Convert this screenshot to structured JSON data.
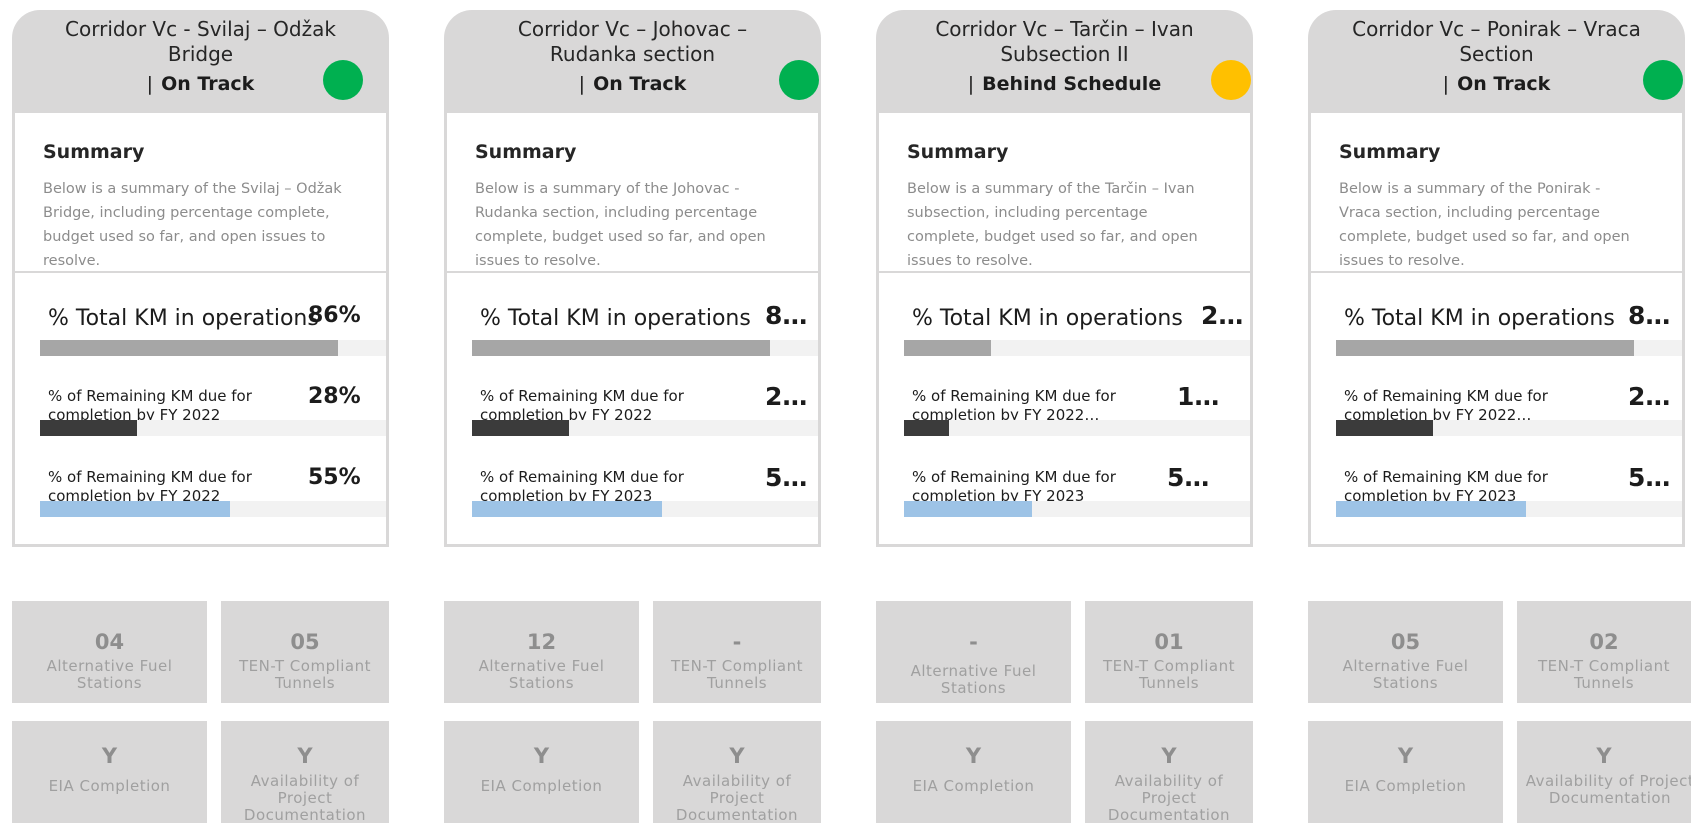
{
  "cards": [
    {
      "title": "Corridor Vc -  Svilaj – Odžak Bridge",
      "status": "On Track",
      "status_color": "#00b050",
      "summary_heading": "Summary",
      "summary_text": "Below is a summary of the Svilaj – Odžak Bridge, including percentage complete, budget used so far, and open issues to resolve.",
      "metric1": {
        "label": "% Total KM in operations",
        "value": "86%",
        "fraction": 0.86
      },
      "metric2": {
        "label": "% of Remaining KM due for completion by FY 2022",
        "value": "28%",
        "fraction": 0.28
      },
      "metric3": {
        "label": "% of Remaining KM due for completion by FY 2022",
        "value": "55%",
        "fraction": 0.55
      },
      "tiles": [
        {
          "value": "04",
          "label": "Alternative Fuel Stations"
        },
        {
          "value": "05",
          "label": "TEN-T Compliant Tunnels"
        },
        {
          "value": "Y",
          "label": "EIA Completion"
        },
        {
          "value": "Y",
          "label": "Availability of Project Documentation"
        }
      ]
    },
    {
      "title": "Corridor Vc – Johovac – Rudanka section",
      "status": "On Track",
      "status_color": "#00b050",
      "summary_heading": "Summary",
      "summary_text": "Below is a summary of the Johovac - Rudanka section, including percentage complete, budget used so far, and open issues to resolve.",
      "metric1": {
        "label": "% Total KM in operations",
        "value": "8…",
        "fraction": 0.86
      },
      "metric2": {
        "label": "% of Remaining KM due for completion by FY 2022",
        "value": "2…",
        "fraction": 0.28
      },
      "metric3": {
        "label": "% of Remaining KM due for completion by FY 2023",
        "value": "5…",
        "fraction": 0.55
      },
      "tiles": [
        {
          "value": "12",
          "label": "Alternative Fuel Stations"
        },
        {
          "value": "-",
          "label": "TEN-T Compliant Tunnels"
        },
        {
          "value": "Y",
          "label": "EIA Completion"
        },
        {
          "value": "Y",
          "label": "Availability of Project Documentation"
        }
      ]
    },
    {
      "title": "Corridor Vc – Tarčin – Ivan Subsection II",
      "status": "Behind Schedule",
      "status_color": "#ffc000",
      "summary_heading": "Summary",
      "summary_text": "Below is a summary of the Tarčin – Ivan subsection, including percentage complete, budget used so far, and open issues to resolve.",
      "metric1": {
        "label": "% Total KM in operations",
        "value": "2…",
        "fraction": 0.25
      },
      "metric2": {
        "label": "% of Remaining KM due for completion by FY 2022…",
        "value": "1…",
        "fraction": 0.13
      },
      "metric3": {
        "label": "% of Remaining KM due for completion by FY 2023",
        "value": "5…",
        "fraction": 0.37
      },
      "tiles": [
        {
          "value": "-",
          "label": "Alternative Fuel Stations"
        },
        {
          "value": "01",
          "label": "TEN-T Compliant Tunnels"
        },
        {
          "value": "Y",
          "label": "EIA Completion"
        },
        {
          "value": "Y",
          "label": "Availability of Project Documentation"
        }
      ]
    },
    {
      "title": "Corridor Vc – Ponirak – Vraca Section",
      "status": "On Track",
      "status_color": "#00b050",
      "summary_heading": "Summary",
      "summary_text": "Below is a summary of the Ponirak - Vraca section, including percentage complete, budget used so far, and open issues to resolve.",
      "metric1": {
        "label": "% Total KM in operations",
        "value": "8…",
        "fraction": 0.86
      },
      "metric2": {
        "label": "% of Remaining KM due for completion by FY 2022…",
        "value": "2…",
        "fraction": 0.28
      },
      "metric3": {
        "label": "% of Remaining KM due for completion by FY 2023",
        "value": "5…",
        "fraction": 0.55
      },
      "tiles": [
        {
          "value": "05",
          "label": "Alternative Fuel Stations"
        },
        {
          "value": "02",
          "label": "TEN-T Compliant Tunnels"
        },
        {
          "value": "Y",
          "label": "EIA Completion"
        },
        {
          "value": "Y",
          "label": "Availability of Project Documentation"
        }
      ]
    }
  ]
}
